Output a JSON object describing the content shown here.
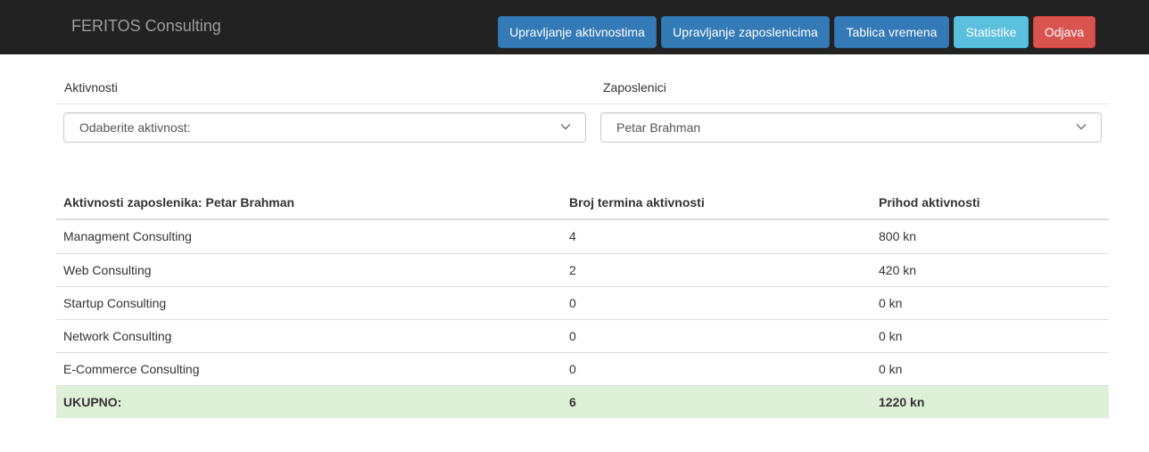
{
  "navbar": {
    "brand": "FERITOS Consulting",
    "buttons": [
      {
        "label": "Upravljanje aktivnostima",
        "variant": "primary"
      },
      {
        "label": "Upravljanje zaposlenicima",
        "variant": "primary"
      },
      {
        "label": "Tablica vremena",
        "variant": "primary"
      },
      {
        "label": "Statistike",
        "variant": "info"
      },
      {
        "label": "Odjava",
        "variant": "danger"
      }
    ]
  },
  "filters": {
    "activities": {
      "label": "Aktivnosti",
      "selected": "Odaberite aktivnost:"
    },
    "employees": {
      "label": "Zaposlenici",
      "selected": "Petar Brahman"
    }
  },
  "table": {
    "headers": [
      "Aktivnosti zaposlenika: Petar Brahman",
      "Broj termina aktivnosti",
      "Prihod aktivnosti"
    ],
    "rows": [
      [
        "Managment Consulting",
        "4",
        "800 kn"
      ],
      [
        "Web Consulting",
        "2",
        "420 kn"
      ],
      [
        "Startup Consulting",
        "0",
        "0 kn"
      ],
      [
        "Network Consulting",
        "0",
        "0 kn"
      ],
      [
        "E-Commerce Consulting",
        "0",
        "0 kn"
      ]
    ],
    "total": [
      "UKUPNO:",
      "6",
      "1220 kn"
    ]
  },
  "icons": {
    "select_chevron": "chevron-down-icon"
  },
  "colors": {
    "navbar_bg": "#222222",
    "primary": "#337ab7",
    "info": "#5bc0de",
    "danger": "#d9534f",
    "total_row_bg": "#dff0d8"
  }
}
